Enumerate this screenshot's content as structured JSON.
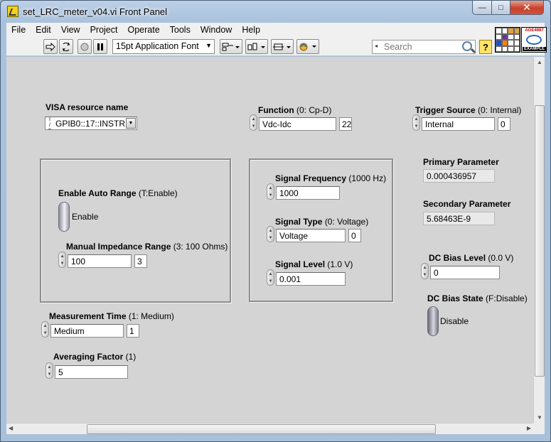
{
  "window": {
    "title": "set_LRC_meter_v04.vi Front Panel",
    "controls": {
      "minimize": "—",
      "maximize": "□",
      "close": "✕"
    }
  },
  "menu": [
    "File",
    "Edit",
    "View",
    "Project",
    "Operate",
    "Tools",
    "Window",
    "Help"
  ],
  "toolbar": {
    "font": "15pt Application Font",
    "search_placeholder": "Search",
    "help_label": "?",
    "icons": [
      "run-arrow-icon",
      "run-continuous-icon",
      "abort-icon",
      "pause-icon",
      "align-icon",
      "distribute-icon",
      "resize-icon",
      "reorder-icon"
    ],
    "example_icon": {
      "top": "AGE4987",
      "bottom": "EXAMPLE"
    }
  },
  "controls": {
    "visa": {
      "name": "VISA resource name",
      "value": "GPIB0::17::INSTR"
    },
    "function": {
      "name": "Function",
      "hint": "(0: Cp-D)",
      "value": "Vdc-Idc",
      "index": "22"
    },
    "trigger": {
      "name": "Trigger Source",
      "hint": "(0: Internal)",
      "value": "Internal",
      "index": "0"
    },
    "auto_range": {
      "name": "Enable Auto Range",
      "hint": "(T:Enable)",
      "state": "Enable"
    },
    "impedance": {
      "name": "Manual Impedance Range",
      "hint": "(3: 100 Ohms)",
      "value": "100",
      "index": "3"
    },
    "sig_freq": {
      "name": "Signal Frequency",
      "hint": "(1000 Hz)",
      "value": "1000"
    },
    "sig_type": {
      "name": "Signal Type",
      "hint": "(0: Voltage)",
      "value": "Voltage",
      "index": "0"
    },
    "sig_level": {
      "name": "Signal Level",
      "hint": "(1.0 V)",
      "value": "0.001"
    },
    "meas_time": {
      "name": "Measurement Time",
      "hint": "(1: Medium)",
      "value": "Medium",
      "index": "1"
    },
    "avg": {
      "name": "Averaging Factor",
      "hint": "(1)",
      "value": "5"
    },
    "primary": {
      "name": "Primary Parameter",
      "value": "0.000436957"
    },
    "secondary": {
      "name": "Secondary Parameter",
      "value": "5.68463E-9"
    },
    "dc_bias_level": {
      "name": "DC Bias Level",
      "hint": "(0.0 V)",
      "value": "0"
    },
    "dc_bias_state": {
      "name": "DC Bias State",
      "hint": "(F:Disable)",
      "state": "Disable"
    }
  }
}
